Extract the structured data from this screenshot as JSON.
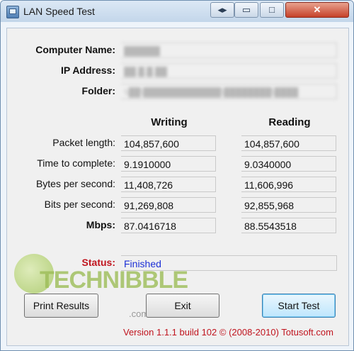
{
  "window": {
    "title": "LAN Speed Test",
    "buttons": {
      "extra": "◂▸",
      "minimize_icon": "▭",
      "restore_icon": "□",
      "close_icon": "✕"
    }
  },
  "info": {
    "computer_name_label": "Computer Name:",
    "computer_name_value": "██████",
    "ip_label": "IP Address:",
    "ip_value": "██.█.█.██",
    "folder_label": "Folder:",
    "folder_value": "\\\\██\\█████████████\\████████\\████"
  },
  "results": {
    "writing_header": "Writing",
    "reading_header": "Reading",
    "rows": [
      {
        "label": "Packet length:",
        "writing": "104,857,600",
        "reading": "104,857,600",
        "bold": false
      },
      {
        "label": "Time to complete:",
        "writing": "9.1910000",
        "reading": "9.0340000",
        "bold": false
      },
      {
        "label": "Bytes per second:",
        "writing": "11,408,726",
        "reading": "11,606,996",
        "bold": false
      },
      {
        "label": "Bits per second:",
        "writing": "91,269,808",
        "reading": "92,855,968",
        "bold": false
      },
      {
        "label": "Mbps:",
        "writing": "87.0416718",
        "reading": "88.5543518",
        "bold": true
      }
    ]
  },
  "status": {
    "label": "Status:",
    "value": "Finished"
  },
  "watermark": {
    "brand": "TECHNIBBLE",
    "domain": ".com"
  },
  "buttons": {
    "print": "Print Results",
    "exit": "Exit",
    "start": "Start Test"
  },
  "footer": {
    "version": "Version 1.1.1 build 102 © (2008-2010) Totusoft.com"
  },
  "colors": {
    "status_red": "#c0141e",
    "status_value_blue": "#1c2fd6",
    "accent_focus": "#3c7fb1"
  }
}
